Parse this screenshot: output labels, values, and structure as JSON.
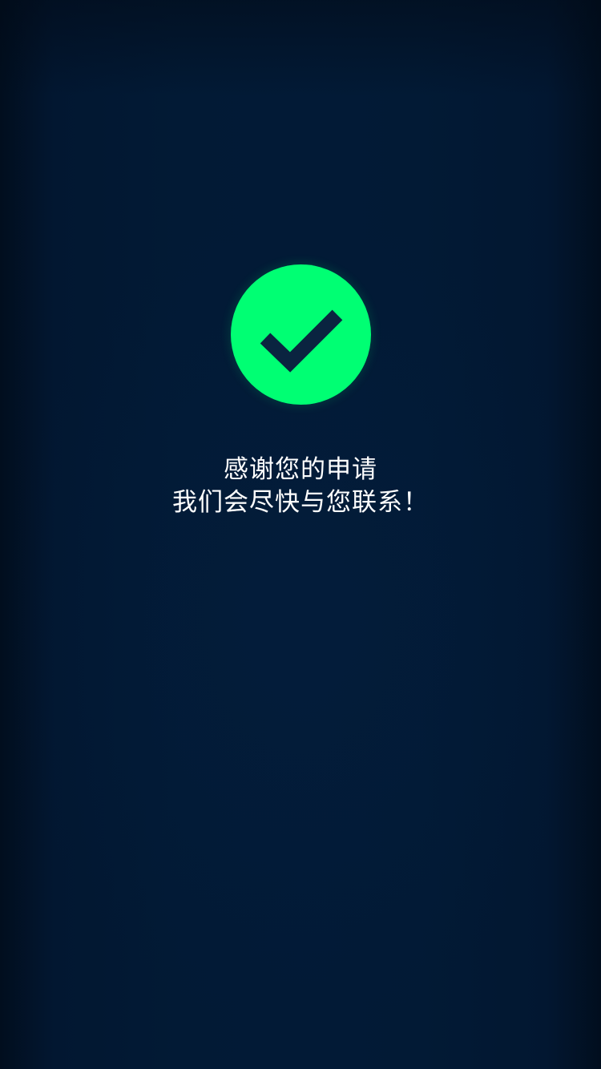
{
  "screen": {
    "status_icon": "check-circle-icon",
    "accent_color": "#00ff73",
    "background_color": "#021a35",
    "title": "感谢您的申请",
    "subtitle": "我们会尽快与您联系！"
  }
}
